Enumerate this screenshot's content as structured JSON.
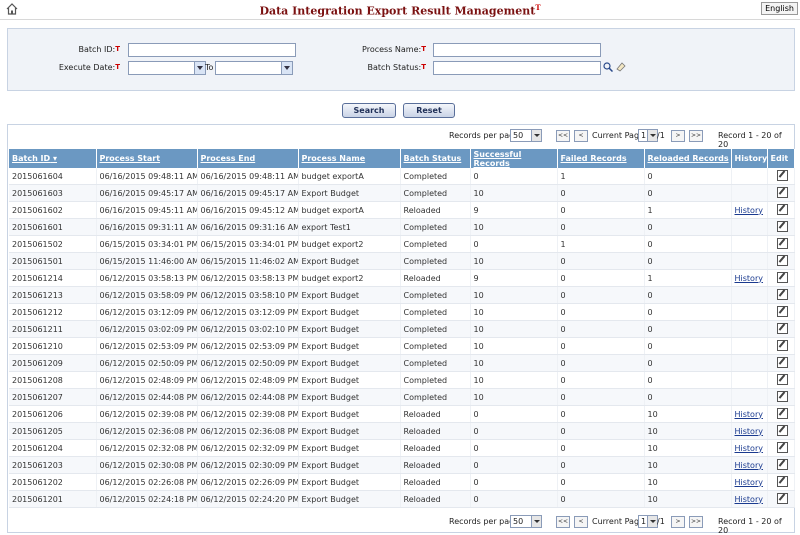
{
  "page": {
    "title": "Data Integration Export Result Management",
    "lang_button": "English"
  },
  "filter": {
    "batch_id_label": "Batch ID:",
    "execute_date_label": "Execute Date:",
    "to_label": "To",
    "process_name_label": "Process Name:",
    "batch_status_label": "Batch Status:",
    "req_mark": "T"
  },
  "actions": {
    "search": "Search",
    "reset": "Reset"
  },
  "pager": {
    "records_per_page_label": "Records per page",
    "records_per_page": "50",
    "first": "<<",
    "prev": "<",
    "next": ">",
    "last": ">>",
    "current_page_label": "Current Page",
    "current_page": "1",
    "total_pages": "/1",
    "record_info": "Record 1 - 20 of 20"
  },
  "columns": [
    "Batch ID",
    "Process Start",
    "Process End",
    "Process Name",
    "Batch Status",
    "Successful Records",
    "Failed Records",
    "Reloaded Records",
    "History",
    "Edit"
  ],
  "rows": [
    [
      "2015061604",
      "06/16/2015 09:48:11 AM",
      "06/16/2015 09:48:11 AM",
      "budget exportA",
      "Completed",
      "0",
      "1",
      "0",
      ""
    ],
    [
      "2015061603",
      "06/16/2015 09:45:17 AM",
      "06/16/2015 09:45:17 AM",
      "Export Budget",
      "Completed",
      "10",
      "0",
      "0",
      ""
    ],
    [
      "2015061602",
      "06/16/2015 09:45:11 AM",
      "06/16/2015 09:45:12 AM",
      "budget exportA",
      "Reloaded",
      "9",
      "0",
      "1",
      "History"
    ],
    [
      "2015061601",
      "06/16/2015 09:31:11 AM",
      "06/16/2015 09:31:16 AM",
      "export Test1",
      "Completed",
      "10",
      "0",
      "0",
      ""
    ],
    [
      "2015061502",
      "06/15/2015 03:34:01 PM",
      "06/15/2015 03:34:01 PM",
      "budget export2",
      "Completed",
      "0",
      "1",
      "0",
      ""
    ],
    [
      "2015061501",
      "06/15/2015 11:46:00 AM",
      "06/15/2015 11:46:02 AM",
      "Export Budget",
      "Completed",
      "10",
      "0",
      "0",
      ""
    ],
    [
      "2015061214",
      "06/12/2015 03:58:13 PM",
      "06/12/2015 03:58:13 PM",
      "budget export2",
      "Reloaded",
      "9",
      "0",
      "1",
      "History"
    ],
    [
      "2015061213",
      "06/12/2015 03:58:09 PM",
      "06/12/2015 03:58:10 PM",
      "Export Budget",
      "Completed",
      "10",
      "0",
      "0",
      ""
    ],
    [
      "2015061212",
      "06/12/2015 03:12:09 PM",
      "06/12/2015 03:12:09 PM",
      "Export Budget",
      "Completed",
      "10",
      "0",
      "0",
      ""
    ],
    [
      "2015061211",
      "06/12/2015 03:02:09 PM",
      "06/12/2015 03:02:10 PM",
      "Export Budget",
      "Completed",
      "10",
      "0",
      "0",
      ""
    ],
    [
      "2015061210",
      "06/12/2015 02:53:09 PM",
      "06/12/2015 02:53:09 PM",
      "Export Budget",
      "Completed",
      "10",
      "0",
      "0",
      ""
    ],
    [
      "2015061209",
      "06/12/2015 02:50:09 PM",
      "06/12/2015 02:50:09 PM",
      "Export Budget",
      "Completed",
      "10",
      "0",
      "0",
      ""
    ],
    [
      "2015061208",
      "06/12/2015 02:48:09 PM",
      "06/12/2015 02:48:09 PM",
      "Export Budget",
      "Completed",
      "10",
      "0",
      "0",
      ""
    ],
    [
      "2015061207",
      "06/12/2015 02:44:08 PM",
      "06/12/2015 02:44:08 PM",
      "Export Budget",
      "Completed",
      "10",
      "0",
      "0",
      ""
    ],
    [
      "2015061206",
      "06/12/2015 02:39:08 PM",
      "06/12/2015 02:39:08 PM",
      "Export Budget",
      "Reloaded",
      "0",
      "0",
      "10",
      "History"
    ],
    [
      "2015061205",
      "06/12/2015 02:36:08 PM",
      "06/12/2015 02:36:08 PM",
      "Export Budget",
      "Reloaded",
      "0",
      "0",
      "10",
      "History"
    ],
    [
      "2015061204",
      "06/12/2015 02:32:08 PM",
      "06/12/2015 02:32:09 PM",
      "Export Budget",
      "Reloaded",
      "0",
      "0",
      "10",
      "History"
    ],
    [
      "2015061203",
      "06/12/2015 02:30:08 PM",
      "06/12/2015 02:30:09 PM",
      "Export Budget",
      "Reloaded",
      "0",
      "0",
      "10",
      "History"
    ],
    [
      "2015061202",
      "06/12/2015 02:26:08 PM",
      "06/12/2015 02:26:09 PM",
      "Export Budget",
      "Reloaded",
      "0",
      "0",
      "10",
      "History"
    ],
    [
      "2015061201",
      "06/12/2015 02:24:18 PM",
      "06/12/2015 02:24:20 PM",
      "Export Budget",
      "Reloaded",
      "0",
      "0",
      "10",
      "History"
    ]
  ],
  "colors": {
    "header_bg": "#6b98c2",
    "title": "#7a1010",
    "required": "#cc0000"
  }
}
